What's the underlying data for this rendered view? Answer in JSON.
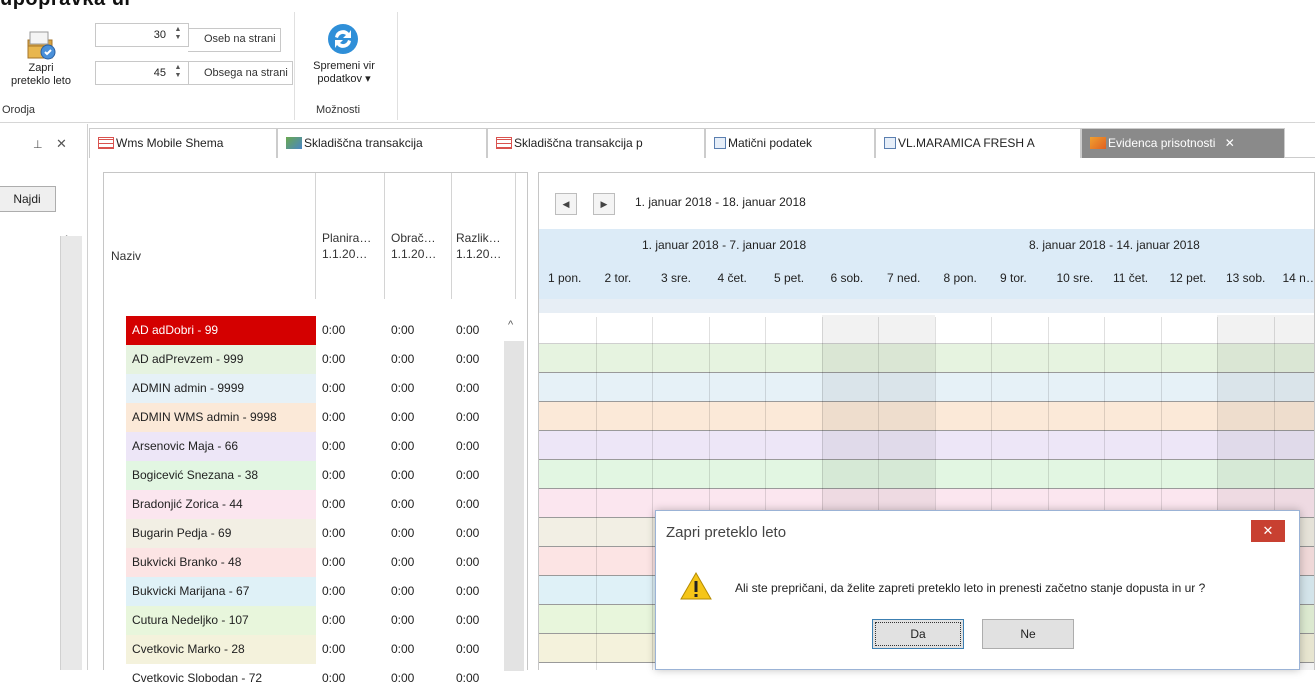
{
  "ribbon": {
    "title": "upopravka ur",
    "close_year_label": "Zapri\npreteklo leto",
    "tools_group": "Orodja",
    "persons_value": "30",
    "persons_label": "Oseb na strani",
    "scope_value": "45",
    "scope_label": "Obsega na strani",
    "change_source_label": "Spremeni vir\npodatkov ▾",
    "options_group": "Možnosti"
  },
  "left_panel": {
    "pin": "⊥",
    "close": "✕",
    "find_button": "Najdi"
  },
  "tabs": [
    {
      "label": "Wms Mobile Shema",
      "icon": "table-icon"
    },
    {
      "label": "Skladiščna transakcija",
      "icon": "transaction-icon"
    },
    {
      "label": "Skladiščna transakcija p",
      "icon": "table-icon"
    },
    {
      "label": "Matični podatek",
      "icon": "document-icon"
    },
    {
      "label": "VL.MARAMICA FRESH A",
      "icon": "document-icon"
    },
    {
      "label": "Evidenca prisotnosti",
      "icon": "attendance-icon",
      "active": true
    }
  ],
  "grid": {
    "columns": [
      {
        "title": "Naziv",
        "sub": ""
      },
      {
        "title": "Planira…",
        "sub": "1.1.20…"
      },
      {
        "title": "Obrač…",
        "sub": "1.1.20…"
      },
      {
        "title": "Razlik…",
        "sub": "1.1.20…"
      }
    ],
    "rows": [
      {
        "name": "AD adDobri - 99",
        "plan": "0:00",
        "obr": "0:00",
        "raz": "0:00",
        "color": "#d40000",
        "text_color": "#ffffff"
      },
      {
        "name": "AD adPrevzem - 999",
        "plan": "0:00",
        "obr": "0:00",
        "raz": "0:00",
        "color": "#e6f3e0",
        "text_color": "#222222"
      },
      {
        "name": "ADMIN admin - 9999",
        "plan": "0:00",
        "obr": "0:00",
        "raz": "0:00",
        "color": "#e6f1f7",
        "text_color": "#222222"
      },
      {
        "name": "ADMIN WMS admin - 9998",
        "plan": "0:00",
        "obr": "0:00",
        "raz": "0:00",
        "color": "#fbe9d8",
        "text_color": "#222222"
      },
      {
        "name": "Arsenovic Maja - 66",
        "plan": "0:00",
        "obr": "0:00",
        "raz": "0:00",
        "color": "#ede6f7",
        "text_color": "#222222"
      },
      {
        "name": "Bogicević Snezana - 38",
        "plan": "0:00",
        "obr": "0:00",
        "raz": "0:00",
        "color": "#e2f6e2",
        "text_color": "#222222"
      },
      {
        "name": "Bradonjić Zorica - 44",
        "plan": "0:00",
        "obr": "0:00",
        "raz": "0:00",
        "color": "#fbe6ef",
        "text_color": "#222222"
      },
      {
        "name": "Bugarin Pedja - 69",
        "plan": "0:00",
        "obr": "0:00",
        "raz": "0:00",
        "color": "#f2efe4",
        "text_color": "#222222"
      },
      {
        "name": "Bukvicki Branko - 48",
        "plan": "0:00",
        "obr": "0:00",
        "raz": "0:00",
        "color": "#fce4e4",
        "text_color": "#222222"
      },
      {
        "name": "Bukvicki Marijana - 67",
        "plan": "0:00",
        "obr": "0:00",
        "raz": "0:00",
        "color": "#dff1f7",
        "text_color": "#222222"
      },
      {
        "name": "Cutura Nedeljko - 107",
        "plan": "0:00",
        "obr": "0:00",
        "raz": "0:00",
        "color": "#e8f6dc",
        "text_color": "#222222"
      },
      {
        "name": "Cvetkovic  Marko - 28",
        "plan": "0:00",
        "obr": "0:00",
        "raz": "0:00",
        "color": "#f4f2dc",
        "text_color": "#222222"
      },
      {
        "name": "Cvetkovic Slobodan - 72",
        "plan": "0:00",
        "obr": "0:00",
        "raz": "0:00",
        "color": "#ffffff",
        "text_color": "#222222"
      }
    ]
  },
  "scheduler": {
    "range": "1. januar 2018 - 18. januar 2018",
    "week1": "1. januar 2018 - 7. januar 2018",
    "week2": "8. januar 2018 - 14. januar 2018",
    "days": [
      "1 pon.",
      "2 tor.",
      "3 sre.",
      "4 čet.",
      "5 pet.",
      "6 sob.",
      "7 ned.",
      "8 pon.",
      "9 tor.",
      "10 sre.",
      "11 čet.",
      "12 pet.",
      "13 sob.",
      "14 n…"
    ]
  },
  "dialog": {
    "title": "Zapri preteklo leto",
    "close": "✕",
    "message": "Ali ste prepričani, da želite zapreti preteklo leto in prenesti začetno stanje dopusta in ur ?",
    "yes": "Da",
    "no": "Ne"
  }
}
